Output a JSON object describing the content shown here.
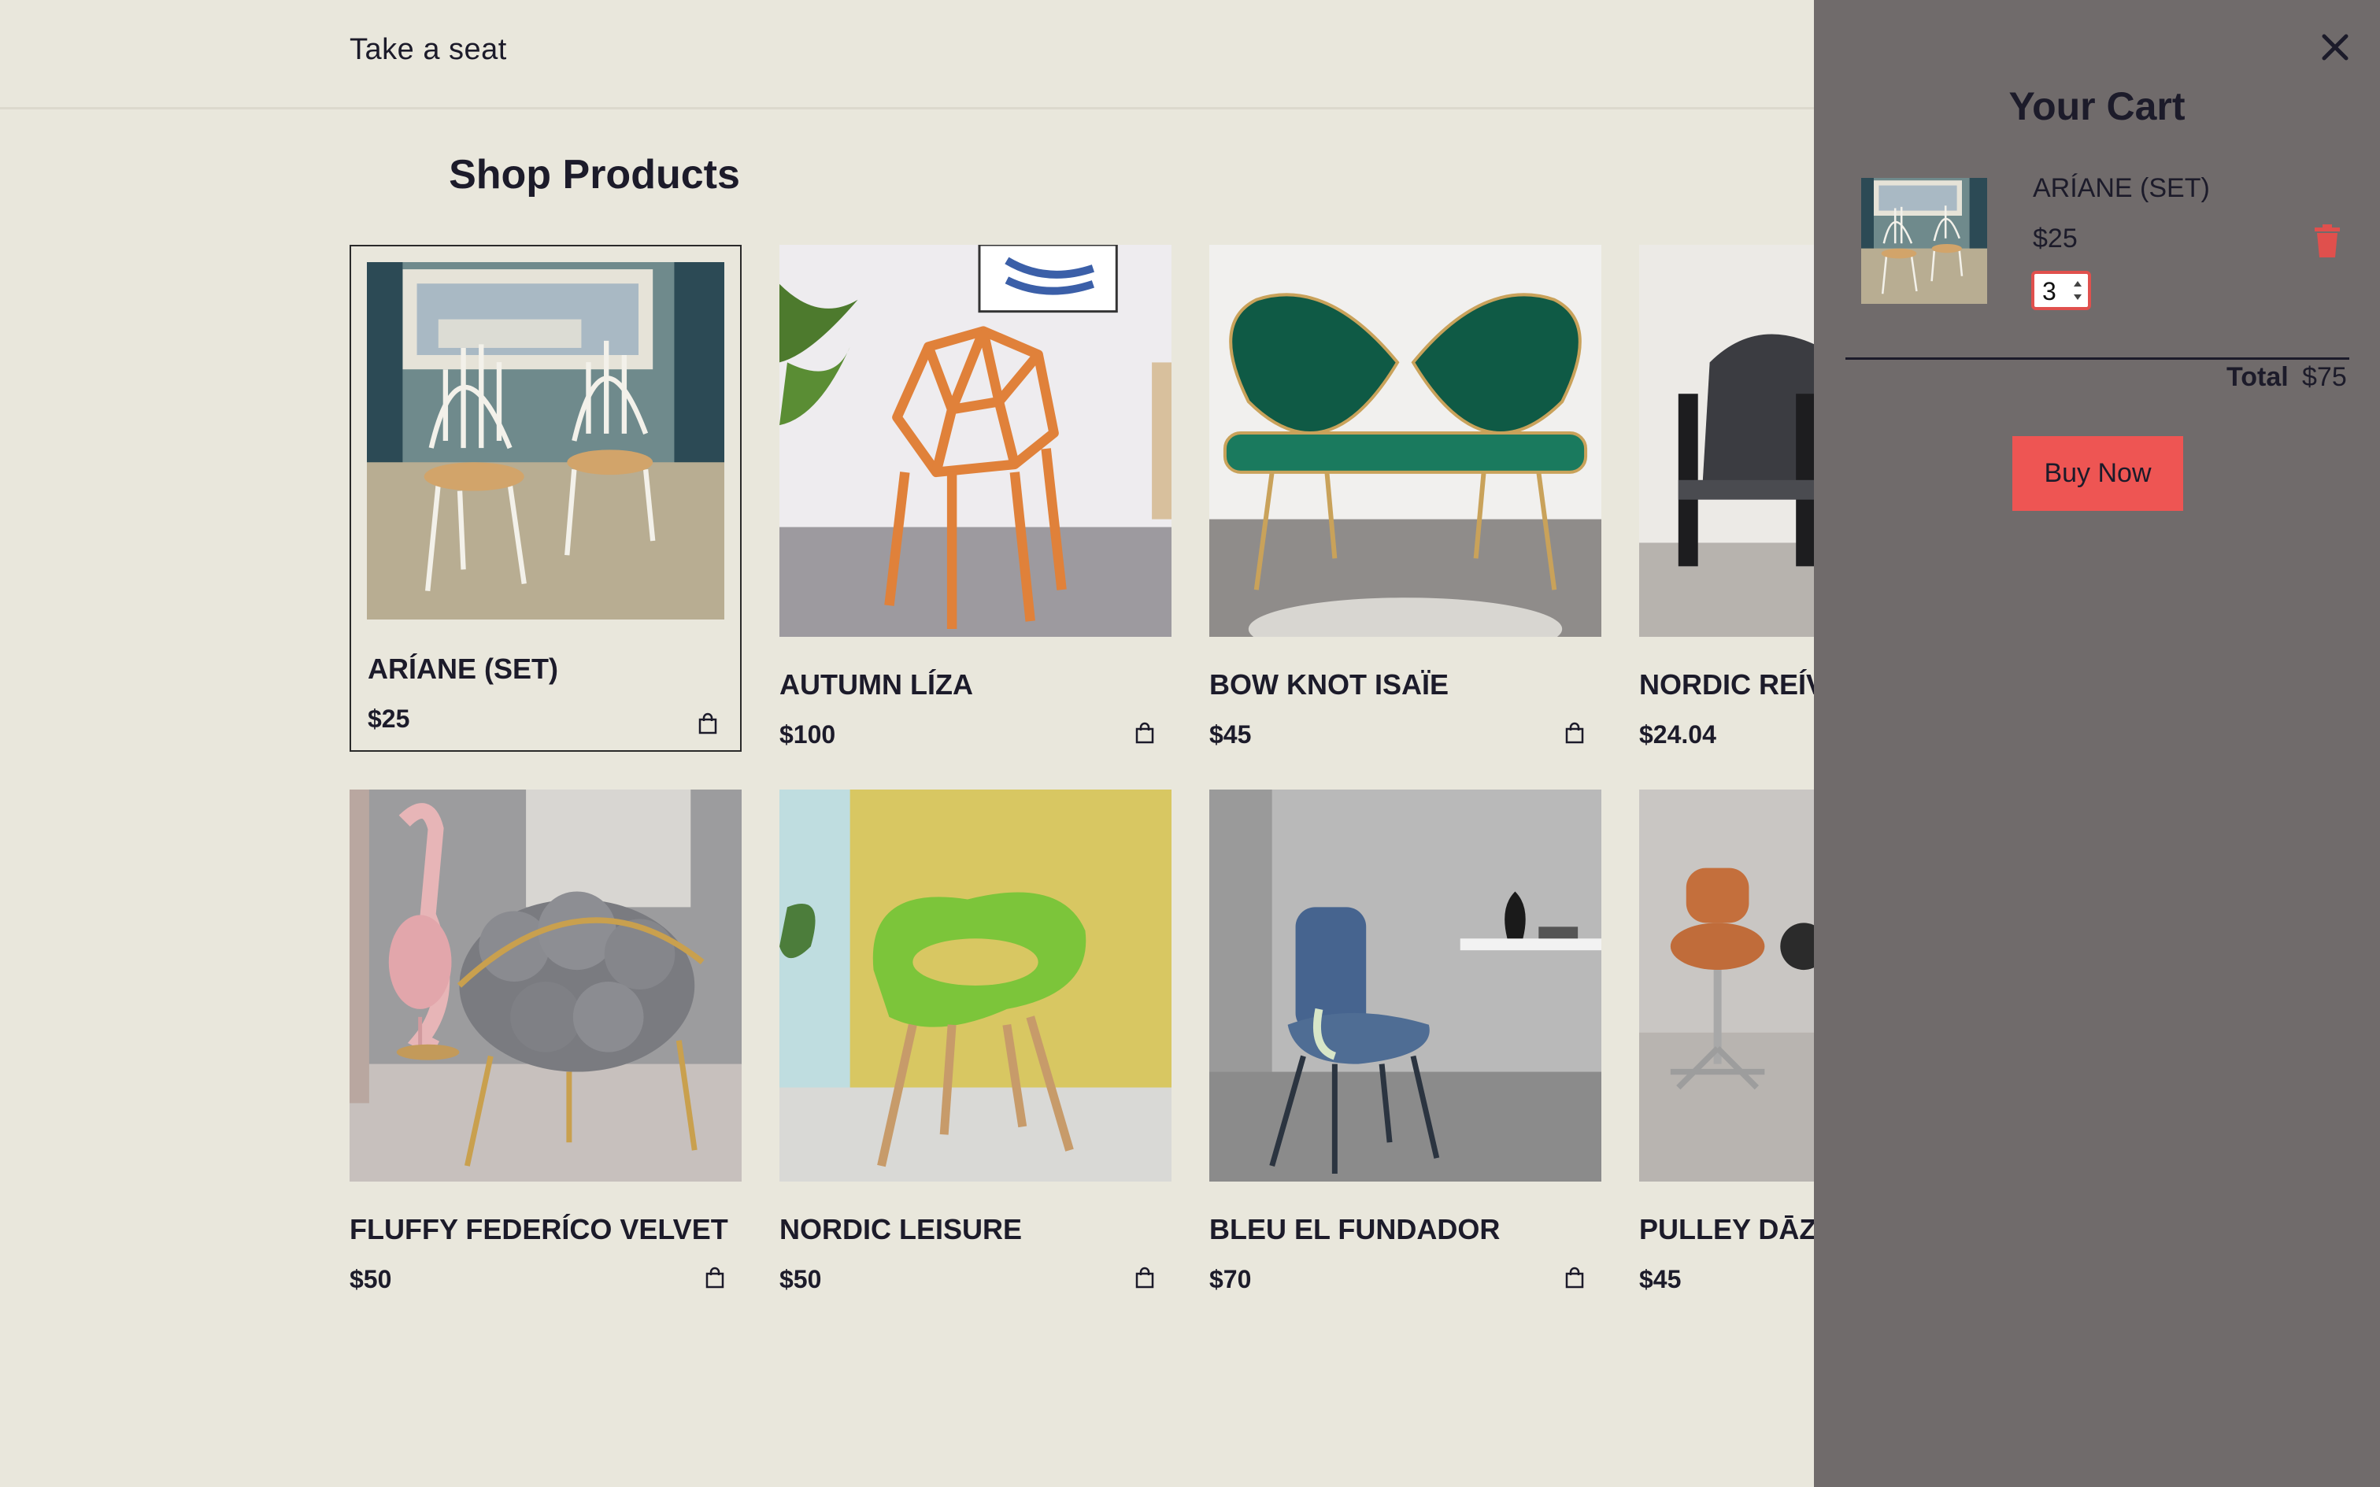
{
  "header": {
    "brand": "Take a seat"
  },
  "main": {
    "title": "Shop Products"
  },
  "products": [
    {
      "name": "ARÍANE (SET)",
      "price": "$25"
    },
    {
      "name": "AUTUMN LÍZA",
      "price": "$100"
    },
    {
      "name": "BOW KNOT ISAÏE",
      "price": "$45"
    },
    {
      "name": "NORDIC REÍV",
      "price": "$24.04"
    },
    {
      "name": "FLUFFY FEDERÍCO VELVET",
      "price": "$50"
    },
    {
      "name": "NORDIC LEISURE",
      "price": "$50"
    },
    {
      "name": "BLEU EL FUNDADOR",
      "price": "$70"
    },
    {
      "name": "PULLEY DĀZĒ",
      "price": "$45"
    }
  ],
  "cart": {
    "title": "Your Cart",
    "item": {
      "name": "ARÍANE (SET)",
      "price": "$25",
      "quantity": "3"
    },
    "total_label": "Total",
    "total_value": "$75",
    "buy_label": "Buy Now"
  },
  "colors": {
    "page_bg": "#e9e7dc",
    "drawer_bg": "#706b6b",
    "accent": "#ee5553",
    "text": "#1c1b2a"
  },
  "icons": [
    "shopping-bag-icon",
    "close-icon",
    "trash-icon"
  ]
}
